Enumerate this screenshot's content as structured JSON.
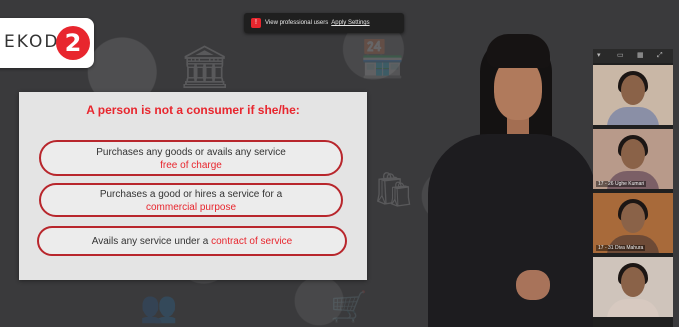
{
  "notice": {
    "text": "View professional users",
    "link": "Apply Settings"
  },
  "logo": {
    "text": "EKODE",
    "mark": "2"
  },
  "slide": {
    "title": "A person is not a consumer if she/he:",
    "items": [
      {
        "text": "Purchases any goods or avails any service",
        "highlight": "free of charge"
      },
      {
        "text": "Purchases a good or hires a service for a",
        "highlight": "commercial purpose"
      },
      {
        "text": "Avails any service under a",
        "highlight": "contract of service"
      }
    ]
  },
  "gallery": {
    "participants": [
      {
        "name": ""
      },
      {
        "name": "17 - 26 Ughe Kumari"
      },
      {
        "name": "17 - 31 Diva Mahura"
      },
      {
        "name": ""
      }
    ]
  },
  "colors": {
    "accent": "#e8262e",
    "slide_bg": "#e4e4e4",
    "backdrop": "#3a3a3c"
  }
}
